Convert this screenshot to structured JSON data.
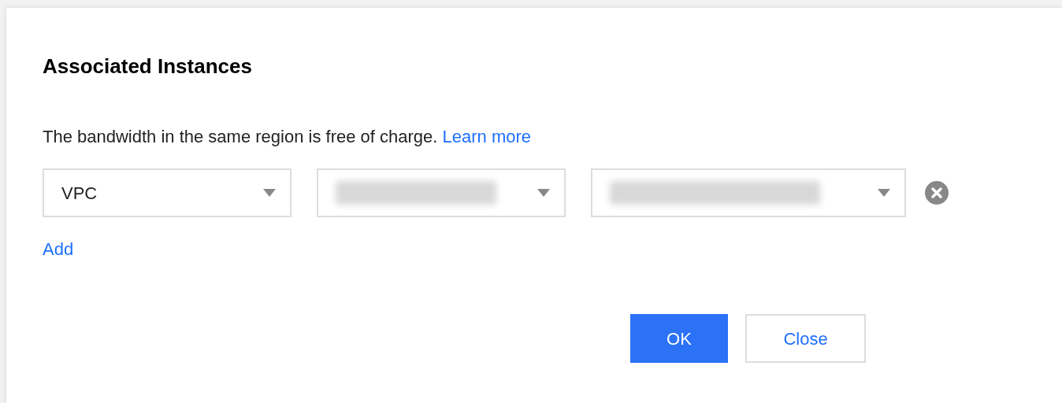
{
  "dialog": {
    "title": "Associated Instances",
    "note": "The bandwidth in the same region is free of charge.",
    "note_link": "Learn more",
    "selects": [
      {
        "kind": "text",
        "value": "VPC"
      },
      {
        "kind": "redacted"
      },
      {
        "kind": "redacted"
      }
    ],
    "add_link": "Add",
    "buttons": [
      {
        "kind": "primary",
        "label": "OK"
      },
      {
        "kind": "secondary",
        "label": "Close"
      }
    ]
  }
}
